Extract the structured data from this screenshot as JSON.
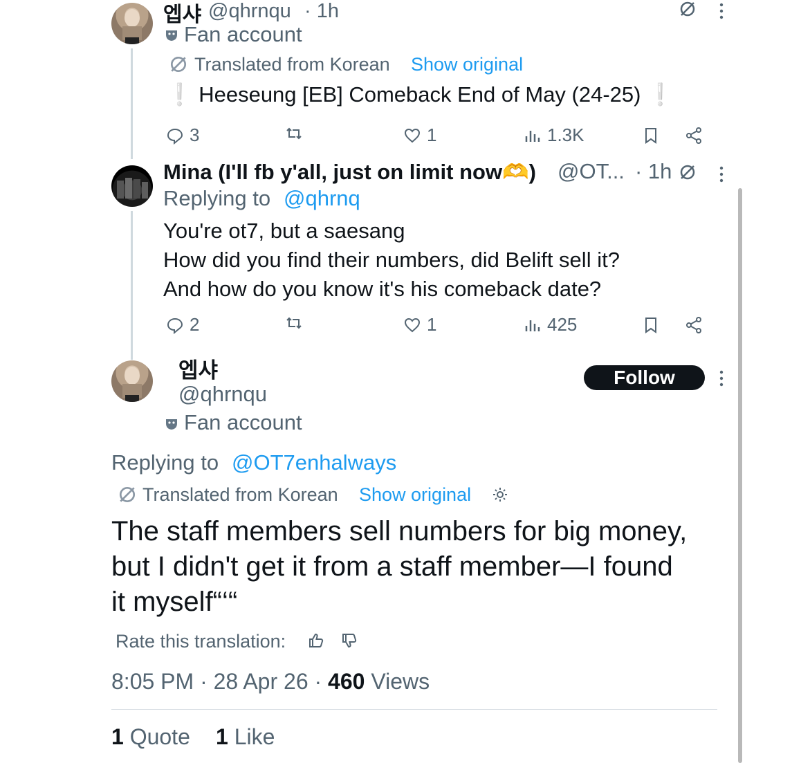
{
  "tweets": [
    {
      "name": "엡샤",
      "handle": "@qhrnqu",
      "time": "· 1h",
      "badge": "Fan account",
      "translation_note": "Translated from Korean",
      "show_original": "Show original",
      "text": "❕ Heeseung [EB] Comeback End of May (24-25) ❕",
      "stats": {
        "replies": "3",
        "views": "1.3K",
        "likes": "1"
      }
    },
    {
      "name": "Mina (I'll fb y'all, just on limit now🫶)",
      "handle": "@OT...",
      "time": "· 1h",
      "replying_prefix": "Replying to",
      "replying_handle": "@qhrnq",
      "lines": [
        "You're ot7, but a saesang",
        "How did you find their numbers, did Belift sell it?",
        "And how do you know it's his comeback date?"
      ],
      "stats": {
        "replies": "2",
        "views": "425",
        "likes": "1"
      }
    }
  ],
  "main_tweet": {
    "name": "엡샤",
    "handle": "@qhrnqu",
    "badge": "Fan account",
    "follow_label": "Follow",
    "replying_prefix": "Replying to",
    "replying_handle": "@OT7enhalways",
    "translation_note": "Translated from Korean",
    "show_original": "Show original",
    "lines": [
      "The staff members sell numbers for big money,",
      "but I didn't get it from a staff member—I found",
      "it myself“‘“"
    ],
    "rate_label": "Rate this translation:",
    "timestamp": "8:05 PM · 28 Apr 26 ·",
    "views_count": "460",
    "views_label": "Views",
    "quote_count": "1",
    "quote_label": "Quote",
    "like_count": "1",
    "like_label": "Like"
  },
  "colors": {
    "accent": "#1d9bf0",
    "secondary": "#536471",
    "primary": "#0f1419"
  }
}
